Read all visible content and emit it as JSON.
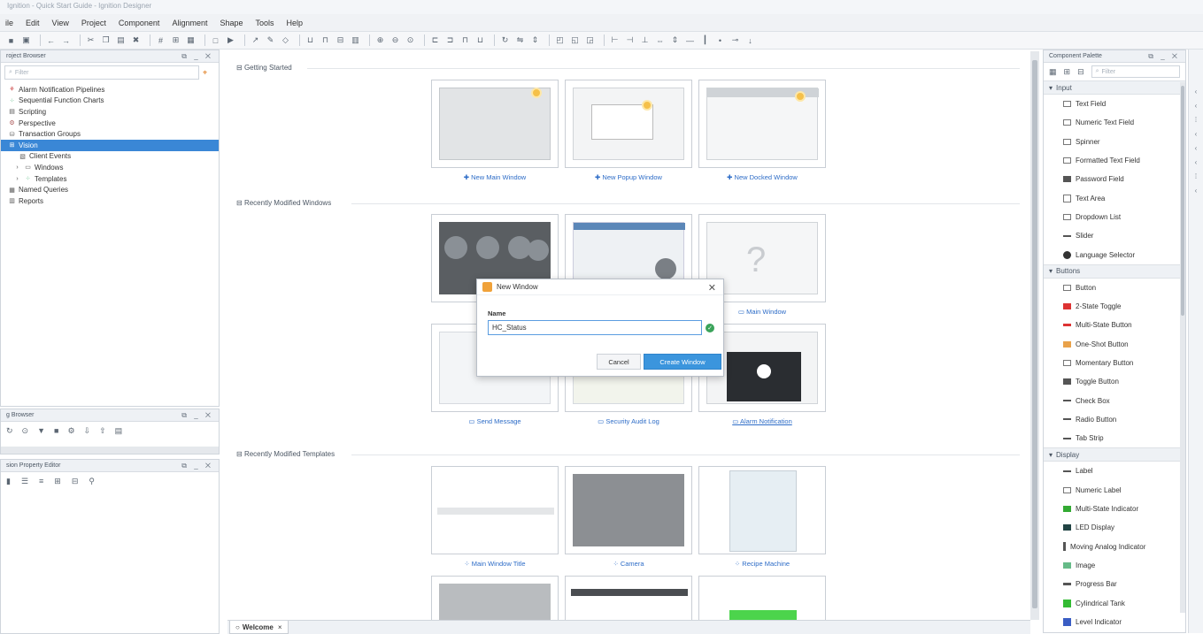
{
  "window": {
    "title": "Ignition - Quick Start Guide - Ignition Designer"
  },
  "menu": [
    "ile",
    "Edit",
    "View",
    "Project",
    "Component",
    "Alignment",
    "Shape",
    "Tools",
    "Help"
  ],
  "project_browser": {
    "title": "roject Browser",
    "filter_placeholder": "Filter",
    "items": [
      {
        "label": "Alarm Notification Pipelines",
        "icon": "pipeline-icon"
      },
      {
        "label": "Sequential Function Charts",
        "icon": "sfc-icon"
      },
      {
        "label": "Scripting",
        "icon": "script-icon"
      },
      {
        "label": "Perspective",
        "icon": "perspective-icon"
      },
      {
        "label": "Transaction Groups",
        "icon": "transaction-icon"
      },
      {
        "label": "Vision",
        "icon": "vision-icon",
        "selected": true
      },
      {
        "label": "Client Events",
        "icon": "event-icon"
      },
      {
        "label": "Windows",
        "icon": "window-icon"
      },
      {
        "label": "Templates",
        "icon": "template-icon"
      },
      {
        "label": "Named Queries",
        "icon": "query-icon"
      },
      {
        "label": "Reports",
        "icon": "report-icon"
      }
    ]
  },
  "tag_browser": {
    "title": "g Browser"
  },
  "property_editor": {
    "title": "sion Property Editor"
  },
  "center": {
    "sections": {
      "getting_started": "Getting Started",
      "recent_windows": "Recently Modified Windows",
      "recent_templates": "Recently Modified Templates"
    },
    "getting_started_cards": [
      "New Main Window",
      "New Popup Window",
      "New Docked Window"
    ],
    "window_cards_row2": [
      "Main Window"
    ],
    "window_cards_row3": [
      "Send Message",
      "Security Audit Log",
      "Alarm Notification"
    ],
    "template_cards": [
      "Main Window Title",
      "Camera",
      "Recipe Machine"
    ]
  },
  "dialog": {
    "title": "New Window",
    "name_label": "Name",
    "name_value": "HC_Status",
    "cancel": "Cancel",
    "create": "Create Window"
  },
  "palette": {
    "title": "Component Palette",
    "filter_placeholder": "Filter",
    "groups": [
      {
        "name": "Input",
        "items": [
          "Text Field",
          "Numeric Text Field",
          "Spinner",
          "Formatted Text Field",
          "Password Field",
          "Text Area",
          "Dropdown List",
          "Slider",
          "Language Selector"
        ]
      },
      {
        "name": "Buttons",
        "items": [
          "Button",
          "2-State Toggle",
          "Multi-State Button",
          "One-Shot Button",
          "Momentary Button",
          "Toggle Button",
          "Check Box",
          "Radio Button",
          "Tab Strip"
        ]
      },
      {
        "name": "Display",
        "items": [
          "Label",
          "Numeric Label",
          "Multi-State Indicator",
          "LED Display",
          "Moving Analog Indicator",
          "Image",
          "Progress Bar",
          "Cylindrical Tank",
          "Level Indicator"
        ]
      }
    ]
  },
  "tabs": {
    "welcome": "Welcome"
  }
}
